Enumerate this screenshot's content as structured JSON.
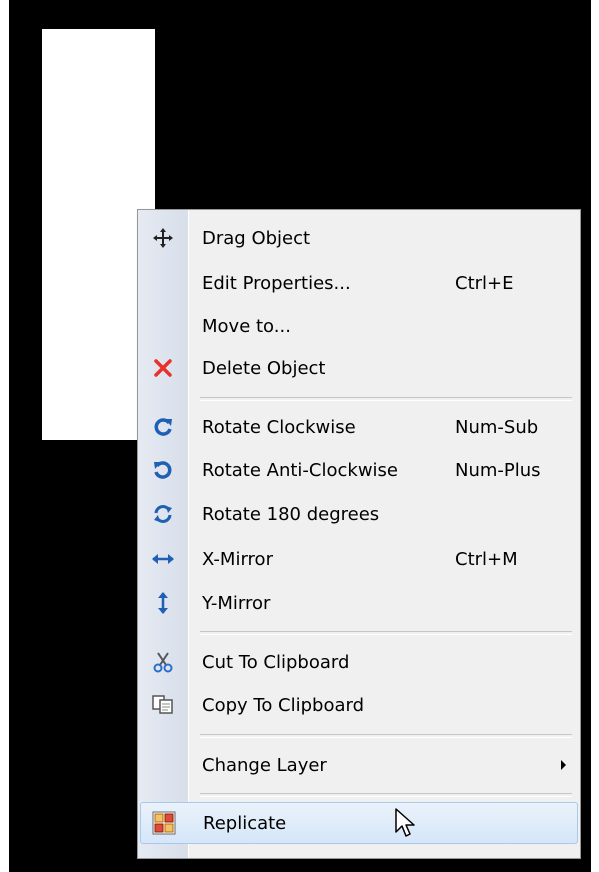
{
  "menu": {
    "items": [
      {
        "label": "Drag Object",
        "shortcut": "",
        "icon": "move-arrows-icon"
      },
      {
        "label": "Edit Properties...",
        "shortcut": "Ctrl+E",
        "icon": ""
      },
      {
        "label": "Move to...",
        "shortcut": "",
        "icon": ""
      },
      {
        "label": "Delete Object",
        "shortcut": "",
        "icon": "delete-x-icon"
      },
      {
        "label": "Rotate Clockwise",
        "shortcut": "Num-Sub",
        "icon": "rotate-clockwise-icon"
      },
      {
        "label": "Rotate Anti-Clockwise",
        "shortcut": "Num-Plus",
        "icon": "rotate-anticlockwise-icon"
      },
      {
        "label": "Rotate 180 degrees",
        "shortcut": "",
        "icon": "rotate-180-icon"
      },
      {
        "label": "X-Mirror",
        "shortcut": "Ctrl+M",
        "icon": "x-mirror-icon"
      },
      {
        "label": "Y-Mirror",
        "shortcut": "",
        "icon": "y-mirror-icon"
      },
      {
        "label": "Cut To Clipboard",
        "shortcut": "",
        "icon": "scissors-icon"
      },
      {
        "label": "Copy To Clipboard",
        "shortcut": "",
        "icon": "copy-icon"
      },
      {
        "label": "Change Layer",
        "shortcut": "",
        "icon": "",
        "submenu": true
      },
      {
        "label": "Replicate",
        "shortcut": "",
        "icon": "replicate-icon",
        "highlighted": true
      }
    ]
  },
  "colors": {
    "menu_bg": "#f0f0f0",
    "highlight": "#d5e6f8",
    "delete_icon": "#e8312a",
    "rotate_icon": "#1f5fb4"
  }
}
